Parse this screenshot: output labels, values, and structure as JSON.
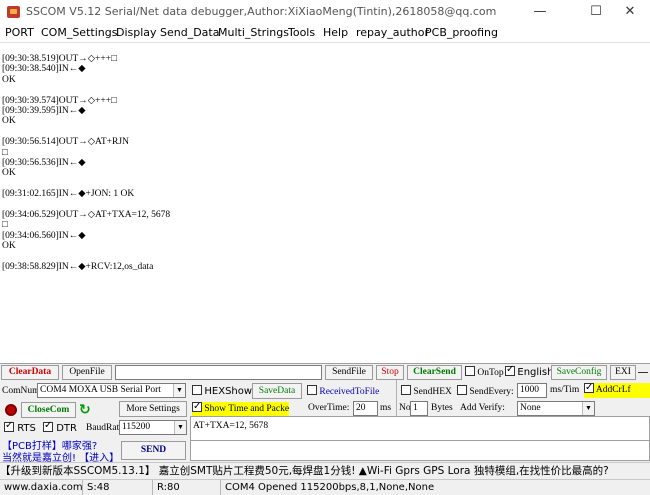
{
  "window": {
    "title": "SSCOM V5.12 Serial/Net data debugger,Author:XiXiaoMeng(Tintin),2618058@qq.com",
    "minimize": "—",
    "maximize": "☐",
    "close": "✕"
  },
  "menu": [
    "PORT",
    "COM_Settings",
    "Display",
    "Send_Data",
    "Multi_Strings",
    "Tools",
    "Help",
    "repay_author",
    "PCB_proofing"
  ],
  "log_lines": [
    "[09:30:38.519]OUT→◇+++□",
    "[09:30:38.540]IN←◆",
    "OK",
    "",
    "[09:30:39.574]OUT→◇+++□",
    "[09:30:39.595]IN←◆",
    "OK",
    "",
    "[09:30:56.514]OUT→◇AT+RJN",
    "□",
    "[09:30:56.536]IN←◆",
    "OK",
    "",
    "[09:31:02.165]IN←◆+JON: 1 OK",
    "",
    "[09:34:06.529]OUT→◇AT+TXA=12, 5678",
    "□",
    "[09:34:06.560]IN←◆",
    "OK",
    "",
    "[09:38:58.829]IN←◆+RCV:12,os_data"
  ],
  "toolbar": {
    "clear_data": "ClearData",
    "open_file": "OpenFile",
    "file_path": "",
    "send_file": "SendFile",
    "stop": "Stop",
    "clear_send": "ClearSend",
    "on_top": "OnTop",
    "english": "English",
    "save_config": "SaveConfig",
    "exit": "EXI"
  },
  "panel": {
    "comnum_label": "ComNum",
    "com_port": "COM4 MOXA USB Serial Port",
    "hex_show": "HEXShow",
    "save_data": "SaveData",
    "received_to_file": "ReceivedToFile",
    "send_hex": "SendHEX",
    "send_every": "SendEvery:",
    "send_every_value": "1000",
    "ms_tim": "ms/Tim",
    "add_crlf": "AddCrLf",
    "close_com": "CloseCom",
    "more_settings": "More Settings",
    "show_time": "Show Time and Packe",
    "overtime": "OverTime:",
    "overtime_value": "20",
    "ms": "ms",
    "no_label": "No",
    "no_value": "1",
    "bytes_label": "Bytes",
    "add_verify": "Add Verify:",
    "verify_value": "None",
    "rts": "RTS",
    "dtr": "DTR",
    "baudrate_label": "BaudRat",
    "baudrate": "115200",
    "send": "SEND",
    "send_text": "AT+TXA=12, 5678",
    "promo_1": "【PCB打样】哪家强?",
    "promo_2": "当然就是嘉立创! 【进入】"
  },
  "ticker": "【升级到新版本SSCOM5.13.1】 嘉立创SMT贴片工程费50元,每焊盘1分钱! ▲Wi-Fi Gprs GPS Lora 独特模组,在找性价比最高的?",
  "status": {
    "site": "www.daxia.com",
    "sent": "S:48",
    "received": "R:80",
    "port_status": "COM4 Opened  115200bps,8,1,None,None"
  },
  "colors": {
    "accent_red": "#d00000",
    "accent_green": "#007a00",
    "accent_blue": "#0000c0",
    "highlight_yellow": "#ffff00"
  }
}
